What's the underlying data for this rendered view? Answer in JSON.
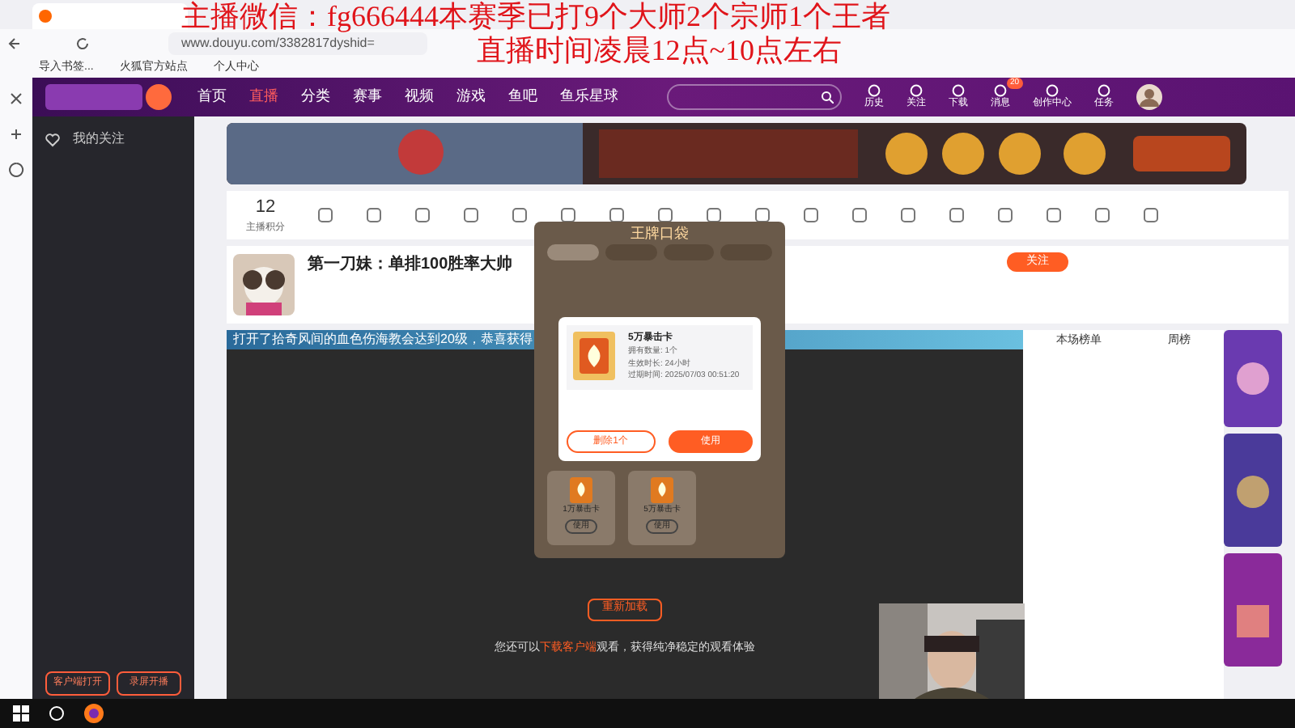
{
  "overlay_text": [
    "主播微信：fg666444本赛季已打9个大师2个宗师1个王者",
    "直播时间凌晨12点~10点左右"
  ],
  "browser": {
    "url": "www.douyu.com/3382817dyshid=",
    "bookmarks": [
      "导入书签...",
      "火狐官方站点",
      "个人中心"
    ]
  },
  "site_nav": [
    {
      "label": "首页",
      "selected": false
    },
    {
      "label": "直播",
      "selected": true
    },
    {
      "label": "分类",
      "selected": false
    },
    {
      "label": "赛事",
      "selected": false
    },
    {
      "label": "视频",
      "selected": false
    },
    {
      "label": "游戏",
      "selected": false
    },
    {
      "label": "鱼吧",
      "selected": false
    },
    {
      "label": "鱼乐星球",
      "selected": false
    }
  ],
  "header_actions": [
    "历史",
    "关注",
    "下载",
    "消息",
    "创作中心",
    "任务"
  ],
  "message_badge": "20",
  "sidebar": {
    "items": [
      "我的关注"
    ],
    "buttons": [
      "客户端打开",
      "录屏开播"
    ]
  },
  "toolbar": {
    "score": "12",
    "score_label": "主播积分"
  },
  "stream": {
    "title": "第一刀妹：单排100胜率大帅",
    "follow": "关注",
    "marquee": "打开了拾奇风间的血色伤海教会达到20级，恭喜获得"
  },
  "pocket": {
    "title": "王牌口袋",
    "tabs": [
      {
        "selected": true
      },
      {
        "selected": false
      },
      {
        "selected": false
      },
      {
        "selected": false
      }
    ],
    "cards": [
      {
        "name": "1万暴击卡",
        "use": "使用"
      },
      {
        "name": "5万暴击卡",
        "use": "使用"
      }
    ]
  },
  "dialog": {
    "name": "5万暴击卡",
    "lines": [
      "拥有数量: 1个",
      "生效时长: 24小时",
      "过期时间: 2025/07/03 00:51:20"
    ],
    "delete": "删除1个",
    "use": "使用"
  },
  "player": {
    "reload": "重新加载",
    "hint_before": "您还可以",
    "hint_link": "下载客户端",
    "hint_after": "观看，获得纯净稳定的观看体验"
  },
  "chat": {
    "tabs": [
      "本场榜单",
      "周榜"
    ]
  }
}
